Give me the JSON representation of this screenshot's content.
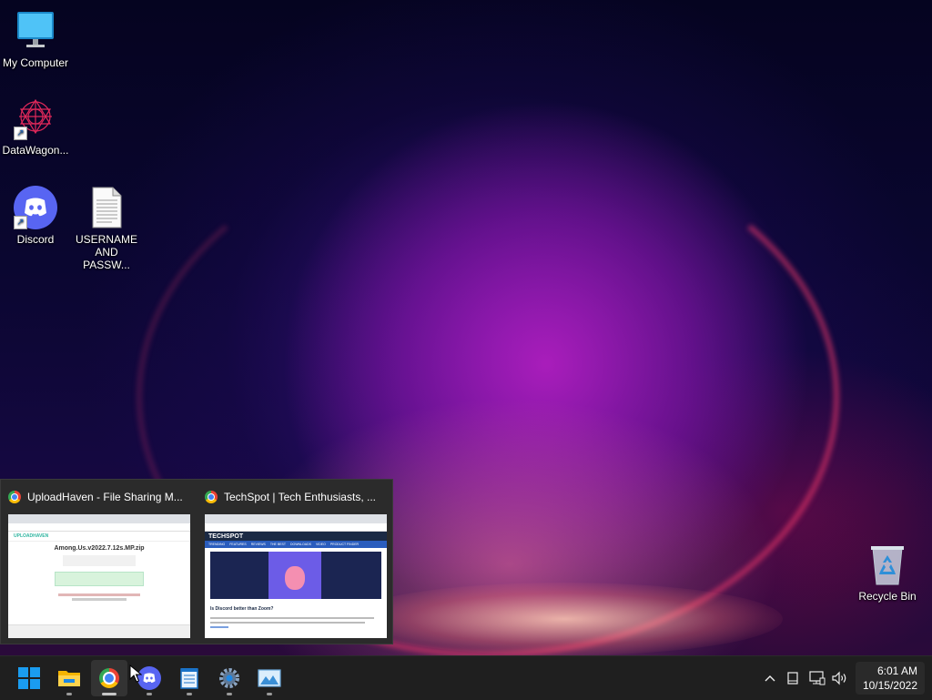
{
  "desktop": {
    "icons": [
      {
        "label": "My Computer",
        "icon": "monitor-icon"
      },
      {
        "label": "DataWagon...",
        "icon": "datawagon-icon"
      },
      {
        "label": "Discord",
        "icon": "discord-icon"
      },
      {
        "label": "USERNAME AND PASSW...",
        "icon": "text-file-icon"
      },
      {
        "label": "Recycle Bin",
        "icon": "recycle-bin-icon"
      }
    ]
  },
  "preview": {
    "windows": [
      {
        "title": "UploadHaven - File Sharing M...",
        "icon": "chrome-icon",
        "content": {
          "site": "UPLOADHAVEN",
          "heading": "Among.Us.v2022.7.12s.MP.zip"
        }
      },
      {
        "title": "TechSpot | Tech Enthusiasts, ...",
        "icon": "chrome-icon",
        "content": {
          "site": "TECHSPOT",
          "nav": [
            "TRENDING",
            "FEATURES",
            "REVIEWS",
            "THE BEST",
            "DOWNLOADS",
            "VIDEO",
            "PRODUCT FINDER"
          ],
          "heading": "Is Discord better than Zoom?"
        }
      }
    ]
  },
  "taskbar": {
    "apps": [
      {
        "name": "start-button",
        "icon": "windows-logo-icon"
      },
      {
        "name": "file-explorer",
        "icon": "folder-icon"
      },
      {
        "name": "chrome",
        "icon": "chrome-icon"
      },
      {
        "name": "discord",
        "icon": "discord-icon"
      },
      {
        "name": "notepad",
        "icon": "notepad-icon"
      },
      {
        "name": "settings",
        "icon": "gear-icon"
      },
      {
        "name": "photos",
        "icon": "picture-icon"
      }
    ],
    "tray": [
      "chevron-up-icon",
      "tablet-icon",
      "network-icon",
      "volume-icon"
    ],
    "clock": {
      "time": "6:01 AM",
      "date": "10/15/2022"
    }
  },
  "colors": {
    "taskbar": "#1f1f1f",
    "accent": "#0078d4",
    "discord": "#5865f2"
  }
}
